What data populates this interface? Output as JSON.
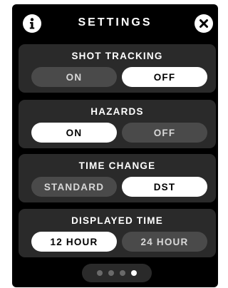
{
  "header": {
    "title": "SETTINGS",
    "info_icon": "info-icon",
    "close_icon": "close-icon"
  },
  "settings": [
    {
      "label": "SHOT TRACKING",
      "options": [
        "ON",
        "OFF"
      ],
      "selected": "OFF"
    },
    {
      "label": "HAZARDS",
      "options": [
        "ON",
        "OFF"
      ],
      "selected": "ON"
    },
    {
      "label": "TIME CHANGE",
      "options": [
        "STANDARD",
        "DST"
      ],
      "selected": "DST"
    },
    {
      "label": "DISPLAYED TIME",
      "options": [
        "12 HOUR",
        "24 HOUR"
      ],
      "selected": "12 HOUR"
    }
  ],
  "pager": {
    "page_count": 4,
    "current_page": 4
  },
  "colors": {
    "background": "#000000",
    "card": "#2a2a2a",
    "active_pill": "#ffffff",
    "inactive_pill": "#4a4a4a"
  }
}
